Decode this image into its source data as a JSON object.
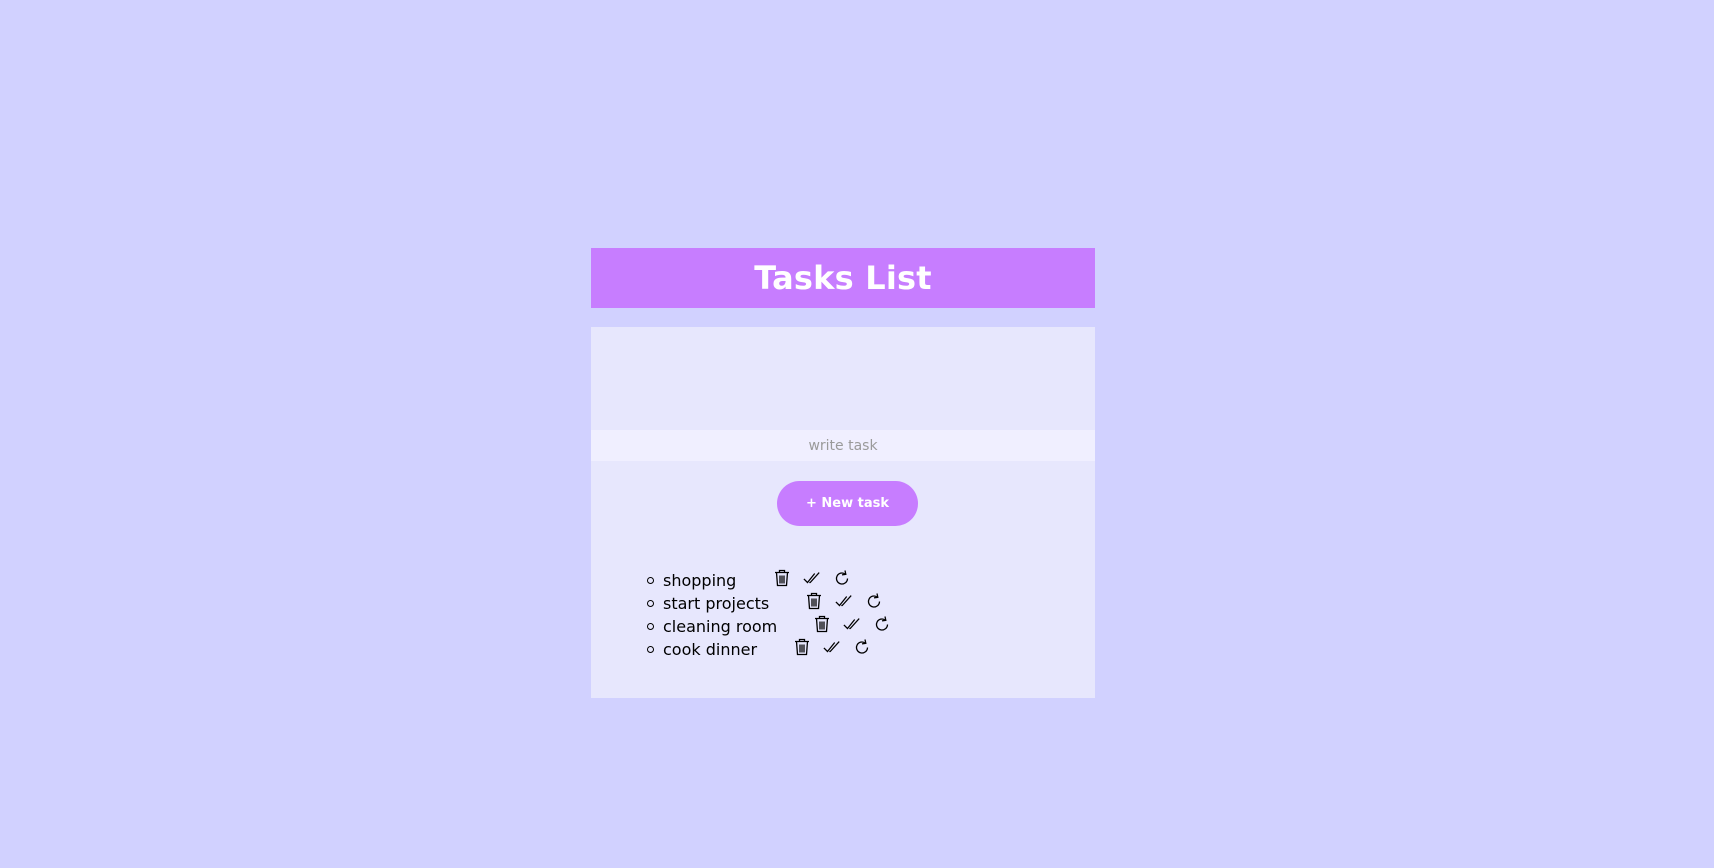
{
  "header": {
    "title": "Tasks List"
  },
  "form": {
    "input_value": "",
    "input_placeholder": "write task",
    "add_button_label": "+ New task"
  },
  "tasks": [
    {
      "label": "shopping"
    },
    {
      "label": "start projects"
    },
    {
      "label": "cleaning room"
    },
    {
      "label": "cook dinner"
    }
  ],
  "icons": {
    "delete": "trash-icon",
    "complete": "double-check-icon",
    "redo": "refresh-icon"
  },
  "colors": {
    "page_bg": "#d1d1ff",
    "accent": "#c77dff",
    "panel_bg": "#e7e7fd",
    "input_bg": "#f0efff"
  }
}
